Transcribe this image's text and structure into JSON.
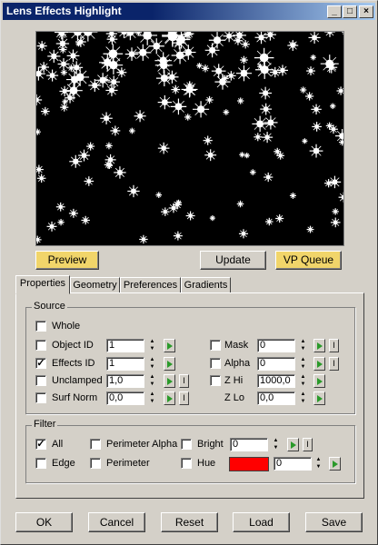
{
  "window": {
    "title": "Lens Effects Highlight",
    "controls": [
      "_",
      "□",
      "×"
    ]
  },
  "buttons": {
    "preview": "Preview",
    "update": "Update",
    "vp_queue": "VP Queue"
  },
  "tabs": [
    "Properties",
    "Geometry",
    "Preferences",
    "Gradients"
  ],
  "source": {
    "label": "Source",
    "whole": {
      "label": "Whole",
      "checked": false
    },
    "object_id": {
      "label": "Object ID",
      "checked": false,
      "value": "1"
    },
    "effects_id": {
      "label": "Effects ID",
      "checked": true,
      "value": "1"
    },
    "unclamped": {
      "label": "Unclamped",
      "checked": false,
      "value": "1,0"
    },
    "surf_norm": {
      "label": "Surf Norm",
      "checked": false,
      "value": "0,0"
    },
    "mask": {
      "label": "Mask",
      "checked": false,
      "value": "0"
    },
    "alpha": {
      "label": "Alpha",
      "checked": false,
      "value": "0"
    },
    "z_hi": {
      "label": "Z Hi",
      "checked": false,
      "value": "1000,0"
    },
    "z_lo": {
      "label": "Z Lo",
      "value": "0,0"
    }
  },
  "filter": {
    "label": "Filter",
    "all": {
      "label": "All",
      "checked": true
    },
    "edge": {
      "label": "Edge",
      "checked": false
    },
    "perimeter_alpha": {
      "label": "Perimeter Alpha",
      "checked": false
    },
    "perimeter": {
      "label": "Perimeter",
      "checked": false
    },
    "bright": {
      "label": "Bright",
      "checked": false,
      "value": "0"
    },
    "hue": {
      "label": "Hue",
      "checked": false,
      "value": "0",
      "color": "#ff0000"
    }
  },
  "footer": {
    "ok": "OK",
    "cancel": "Cancel",
    "reset": "Reset",
    "load": "Load",
    "save": "Save"
  }
}
